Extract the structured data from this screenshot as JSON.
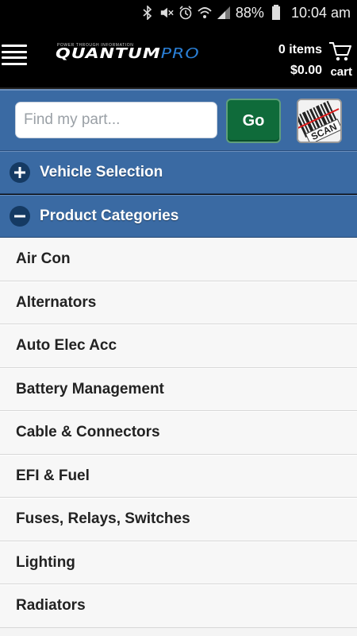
{
  "status_bar": {
    "battery_percent": "88%",
    "time": "10:04 am",
    "icons": [
      "bluetooth-icon",
      "mute-icon",
      "alarm-icon",
      "wifi-icon",
      "signal-icon",
      "battery-icon"
    ]
  },
  "header": {
    "logo_tagline": "POWER THROUGH INFORMATION",
    "logo_brand": "QUANTUM",
    "logo_brand_suffix": "PRO",
    "cart_count": "0 items",
    "cart_total": "$0.00",
    "cart_label": "cart"
  },
  "search": {
    "placeholder": "Find my part...",
    "value": "",
    "go_label": "Go",
    "scan_label": "SCAN"
  },
  "accordion": {
    "vehicle_selection": {
      "label": "Vehicle Selection",
      "icon": "plus",
      "expanded": false
    },
    "product_categories": {
      "label": "Product Categories",
      "icon": "minus",
      "expanded": true
    }
  },
  "categories": [
    "Air Con",
    "Alternators",
    "Auto Elec Acc",
    "Battery Management",
    "Cable & Connectors",
    "EFI & Fuel",
    "Fuses, Relays, Switches",
    "Lighting",
    "Radiators"
  ],
  "colors": {
    "header_bg": "#000000",
    "accent_blue": "#3a6aa3",
    "go_green": "#0f6b3a",
    "brand_blue": "#2a7fd6",
    "list_bg": "#f4f4f4"
  }
}
